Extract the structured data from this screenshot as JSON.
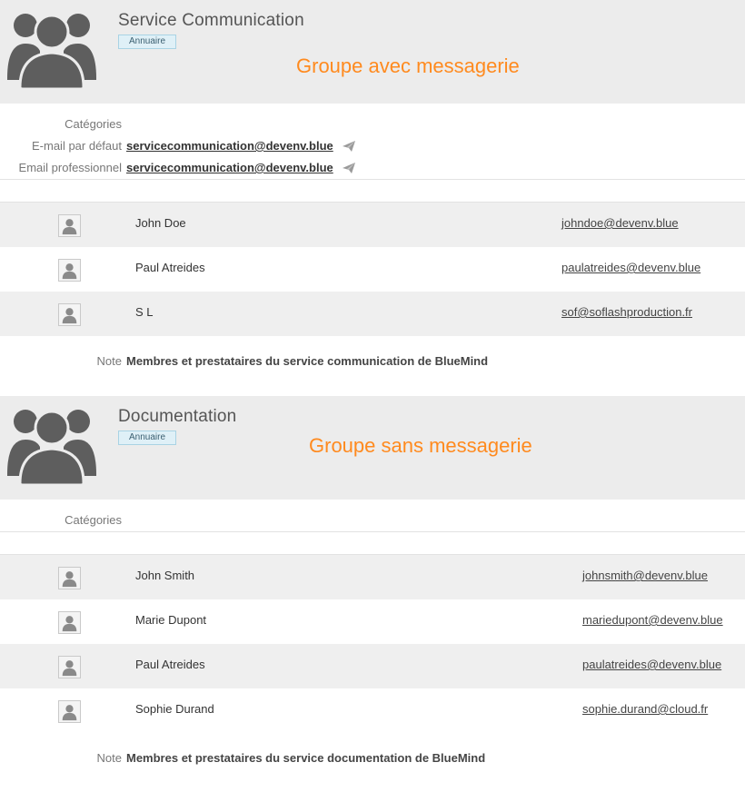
{
  "groups": [
    {
      "title": "Service Communication",
      "badge": "Annuaire",
      "tagline": "Groupe avec messagerie",
      "categories_label": "Catégories",
      "default_email_label": "E-mail par défaut",
      "default_email": "servicecommunication@devenv.blue",
      "pro_email_label": "Email professionnel",
      "pro_email": "servicecommunication@devenv.blue",
      "members": [
        {
          "name": "John Doe",
          "email": "johndoe@devenv.blue"
        },
        {
          "name": "Paul Atreides",
          "email": "paulatreides@devenv.blue"
        },
        {
          "name": "S L",
          "email": "sof@soflashproduction.fr"
        }
      ],
      "note_label": "Note",
      "note": "Membres et prestataires du service communication de BlueMind"
    },
    {
      "title": "Documentation",
      "badge": "Annuaire",
      "tagline": "Groupe sans messagerie",
      "categories_label": "Catégories",
      "members": [
        {
          "name": "John Smith",
          "email": "johnsmith@devenv.blue"
        },
        {
          "name": "Marie Dupont",
          "email": "mariedupont@devenv.blue"
        },
        {
          "name": "Paul Atreides",
          "email": "paulatreides@devenv.blue"
        },
        {
          "name": "Sophie Durand",
          "email": "sophie.durand@cloud.fr"
        }
      ],
      "note_label": "Note",
      "note": "Membres et prestataires du service documentation de BlueMind"
    }
  ],
  "colors": {
    "accent_orange": "#ff8a1e",
    "badge_bg": "#dff0f7",
    "header_bg": "#ececec"
  },
  "icons": {
    "group_avatar": "group-icon",
    "member_avatar": "user-icon",
    "send": "paper-plane-icon"
  }
}
